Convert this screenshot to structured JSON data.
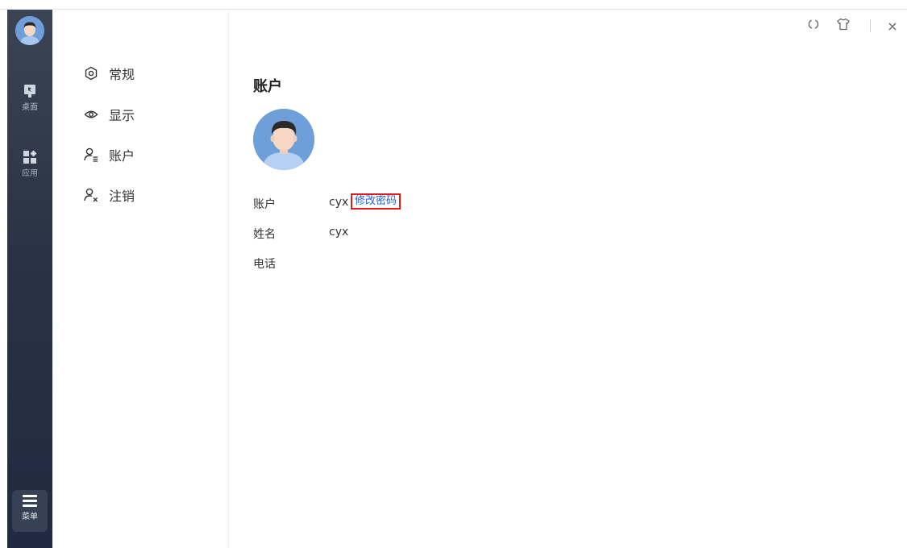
{
  "rail": {
    "items": [
      {
        "label": "桌面",
        "icon": "desktop-icon"
      },
      {
        "label": "应用",
        "icon": "apps-icon"
      }
    ],
    "menu": {
      "label": "菜单",
      "icon": "hamburger-icon"
    }
  },
  "window_controls": {
    "refresh_icon": "refresh-icon",
    "skin_icon": "shirt-icon",
    "close_label": "×"
  },
  "settings_nav": {
    "items": [
      {
        "label": "常规",
        "icon": "general-settings-icon"
      },
      {
        "label": "显示",
        "icon": "eye-icon"
      },
      {
        "label": "账户",
        "icon": "user-list-icon"
      },
      {
        "label": "注销",
        "icon": "user-logout-icon"
      }
    ]
  },
  "account": {
    "title": "账户",
    "fields": [
      {
        "label": "账户",
        "value": "cyx"
      },
      {
        "label": "姓名",
        "value": "cyx"
      },
      {
        "label": "电话",
        "value": ""
      }
    ],
    "change_password_label": "修改密码"
  },
  "colors": {
    "rail_top": "#3b4454",
    "rail_bottom": "#1f2a40",
    "link": "#2a63d6",
    "highlight_border": "#e01b1b"
  }
}
